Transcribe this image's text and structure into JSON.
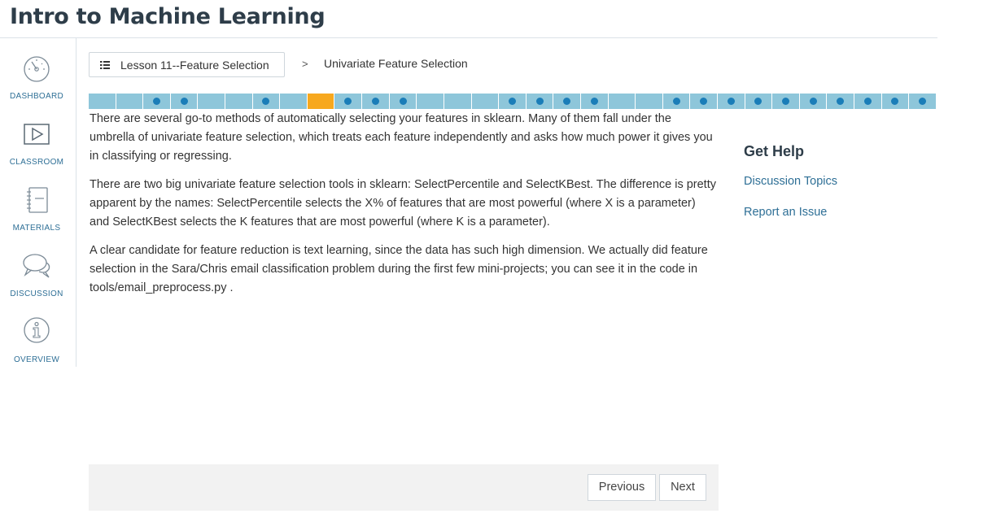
{
  "course_title": "Intro to Machine Learning",
  "sidebar": {
    "items": [
      {
        "label": "DASHBOARD",
        "icon": "gauge-icon"
      },
      {
        "label": "CLASSROOM",
        "icon": "play-icon"
      },
      {
        "label": "MATERIALS",
        "icon": "notebook-icon"
      },
      {
        "label": "DISCUSSION",
        "icon": "chat-bubbles-icon"
      },
      {
        "label": "OVERVIEW",
        "icon": "info-icon"
      }
    ]
  },
  "breadcrumb": {
    "lesson_label": "Lesson 11--Feature Selection",
    "separator": ">",
    "current": "Univariate Feature Selection"
  },
  "progress": {
    "segments": [
      "empty",
      "empty",
      "done",
      "done",
      "empty",
      "empty",
      "done",
      "empty",
      "current",
      "done",
      "done",
      "done",
      "empty",
      "empty",
      "empty",
      "done",
      "done",
      "done",
      "done",
      "empty",
      "empty",
      "done",
      "done",
      "done",
      "done",
      "done",
      "done",
      "done",
      "done",
      "done",
      "done"
    ],
    "colors": {
      "segment": "#8ec6da",
      "current": "#f7a81e",
      "dot": "#1a7db8"
    }
  },
  "content": {
    "paragraphs": [
      "There are several go-to methods of automatically selecting your features in sklearn. Many of them fall under the umbrella of univariate feature selection, which treats each feature independently and asks how much power it gives you in classifying or regressing.",
      "There are two big univariate feature selection tools in sklearn: SelectPercentile and SelectKBest. The difference is pretty apparent by the names: SelectPercentile selects the X% of features that are most powerful (where X is a parameter) and SelectKBest selects the K features that are most powerful (where K is a parameter).",
      "A clear candidate for feature reduction is text learning, since the data has such high dimension. We actually did feature selection in the Sara/Chris email classification problem during the first few mini-projects; you can see it in the code in tools/email_preprocess.py ."
    ]
  },
  "help": {
    "title": "Get Help",
    "links": [
      "Discussion Topics",
      "Report an Issue"
    ]
  },
  "footer": {
    "previous_label": "Previous",
    "next_label": "Next"
  }
}
